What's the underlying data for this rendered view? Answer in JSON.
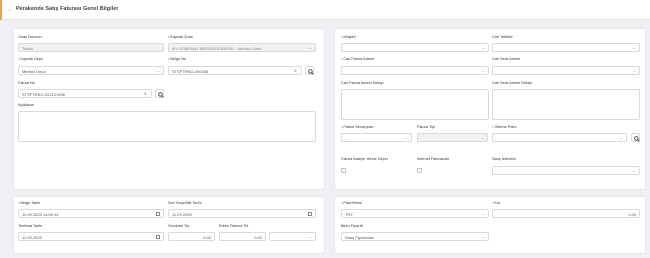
{
  "header": {
    "title": "Perakende Satış Faturası Genel Bilgiler"
  },
  "general": {
    "onay_label": "Onay Durumu",
    "onay_value": "Taslak",
    "kaynak_sube_label": "Kaynak Şube",
    "kaynak_sube_value": "MY COMPANY MERKEZSUBE001 - Merkez Şube",
    "kaynak_depo_label": "Kaynak Depo",
    "kaynak_depo_value": "Merkez Depo",
    "belge_no_label": "Belge No",
    "belge_no_value": "STSFTRNO-000036",
    "fatura_no_label": "Fatura No",
    "fatura_no_value": "STSFTRNO-202101596",
    "aciklama_label": "Açıklama"
  },
  "customer": {
    "musteri_label": "Müşteri",
    "cari_yetkili_label": "Cari Yetkilisi",
    "cari_fatura_adresi_label": "Cari Fatura Adresi",
    "cari_sevk_adresi_label": "Cari Sevk Adresi",
    "cari_fatura_adresi_detay_label": "Cari Fatura Adresi Detayı",
    "cari_sevk_adresi_detay_label": "Cari Sevk Adresi Detayı",
    "fatura_senaryosu_label": "Fatura Senaryosu",
    "fatura_senaryosu_value": "-",
    "fatura_tipi_label": "Fatura Tipi",
    "odeme_plani_label": "Ödeme Planı",
    "irsaliye_label": "Fatura İrsaliye Yerine Geçer",
    "internet_label": "İnternet Faturasıdır",
    "satis_istemesi_label": "Satış İstemesi"
  },
  "dates": {
    "belge_tarihi_label": "Belge Tarihi",
    "belge_tarihi_value": "11.09.2025 14:59:14",
    "son_gecerlilik_label": "Son Geçerlilik Tarihi",
    "son_gecerlilik_value": "11.09.2025",
    "teslimat_label": "Teslimat Tarihi",
    "teslimat_value": "11.09.2025",
    "gecikme_label": "Gecikme Tol.",
    "gecikme_value": "0,00",
    "erken_odeme_label": "Erken Ödeme Tol.",
    "erken_odeme_value": "0,00"
  },
  "currency": {
    "para_birimi_label": "Para Birimi",
    "para_birimi_value": "TRY",
    "kur_label": "Kur",
    "kur_value": "1,00",
    "birim_fiyat_label": "Birim Fiyat Al",
    "birim_fiyat_value": "Satış Fiyatından"
  }
}
